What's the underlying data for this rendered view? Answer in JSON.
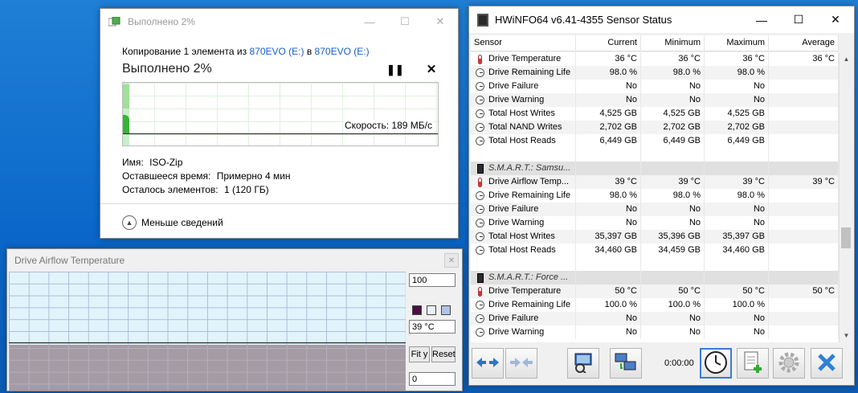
{
  "copy_dialog": {
    "title": "Выполнено 2%",
    "copy_line_prefix": "Копирование 1 элемента из ",
    "source": "870EVO (E:)",
    "copy_line_mid": " в ",
    "destination": "870EVO (E:)",
    "done_label": "Выполнено 2%",
    "progress_percent": 2,
    "speed_label": "Скорость: 189 МБ/с",
    "pause_symbol": "❚❚",
    "stop_symbol": "✕",
    "name_label": "Имя:",
    "name_value": "ISO-Zip",
    "time_label": "Оставшееся время:",
    "time_value": "Примерно 4 мин",
    "items_label": "Осталось элементов:",
    "items_value": "1 (120 ГБ)",
    "less_details": "Меньше сведений",
    "caption": {
      "minimize": "—",
      "maximize": "☐",
      "close": "✕"
    }
  },
  "airflow_graph": {
    "title": "Drive Airflow Temperature",
    "close_symbol": "✕",
    "max_value": "100",
    "current_value": "39 °C",
    "min_value": "0",
    "fit_label": "Fit y",
    "reset_label": "Reset",
    "level_fraction": 0.39,
    "swatch_colors": [
      "#4a1040",
      "#e8f4fb",
      "#b0c4e8"
    ]
  },
  "hwinfo": {
    "title": "HWiNFO64 v6.41-4355 Sensor Status",
    "caption": {
      "minimize": "—",
      "maximize": "☐",
      "close": "✕"
    },
    "columns": [
      "Sensor",
      "Current",
      "Minimum",
      "Maximum",
      "Average"
    ],
    "rows": [
      {
        "type": "thermo",
        "name": "Drive Temperature",
        "cur": "36 °C",
        "min": "36 °C",
        "max": "36 °C",
        "avg": "36 °C"
      },
      {
        "type": "clock",
        "name": "Drive Remaining Life",
        "cur": "98.0 %",
        "min": "98.0 %",
        "max": "98.0 %",
        "avg": ""
      },
      {
        "type": "clock",
        "name": "Drive Failure",
        "cur": "No",
        "min": "No",
        "max": "No",
        "avg": ""
      },
      {
        "type": "clock",
        "name": "Drive Warning",
        "cur": "No",
        "min": "No",
        "max": "No",
        "avg": ""
      },
      {
        "type": "clock",
        "name": "Total Host Writes",
        "cur": "4,525 GB",
        "min": "4,525 GB",
        "max": "4,525 GB",
        "avg": ""
      },
      {
        "type": "clock",
        "name": "Total NAND Writes",
        "cur": "2,702 GB",
        "min": "2,702 GB",
        "max": "2,702 GB",
        "avg": ""
      },
      {
        "type": "clock",
        "name": "Total Host Reads",
        "cur": "6,449 GB",
        "min": "6,449 GB",
        "max": "6,449 GB",
        "avg": ""
      },
      {
        "type": "blank",
        "name": "",
        "cur": "",
        "min": "",
        "max": "",
        "avg": ""
      },
      {
        "type": "group",
        "name": "S.M.A.R.T.: Samsu...",
        "cur": "",
        "min": "",
        "max": "",
        "avg": ""
      },
      {
        "type": "thermo",
        "name": "Drive Airflow Temp...",
        "cur": "39 °C",
        "min": "39 °C",
        "max": "39 °C",
        "avg": "39 °C"
      },
      {
        "type": "clock",
        "name": "Drive Remaining Life",
        "cur": "98.0 %",
        "min": "98.0 %",
        "max": "98.0 %",
        "avg": ""
      },
      {
        "type": "clock",
        "name": "Drive Failure",
        "cur": "No",
        "min": "No",
        "max": "No",
        "avg": ""
      },
      {
        "type": "clock",
        "name": "Drive Warning",
        "cur": "No",
        "min": "No",
        "max": "No",
        "avg": ""
      },
      {
        "type": "clock",
        "name": "Total Host Writes",
        "cur": "35,397 GB",
        "min": "35,396 GB",
        "max": "35,397 GB",
        "avg": ""
      },
      {
        "type": "clock",
        "name": "Total Host Reads",
        "cur": "34,460 GB",
        "min": "34,459 GB",
        "max": "34,460 GB",
        "avg": ""
      },
      {
        "type": "blank",
        "name": "",
        "cur": "",
        "min": "",
        "max": "",
        "avg": ""
      },
      {
        "type": "group",
        "name": "S.M.A.R.T.: Force ...",
        "cur": "",
        "min": "",
        "max": "",
        "avg": ""
      },
      {
        "type": "thermo",
        "name": "Drive Temperature",
        "cur": "50 °C",
        "min": "50 °C",
        "max": "50 °C",
        "avg": "50 °C"
      },
      {
        "type": "clock",
        "name": "Drive Remaining Life",
        "cur": "100.0 %",
        "min": "100.0 %",
        "max": "100.0 %",
        "avg": ""
      },
      {
        "type": "clock",
        "name": "Drive Failure",
        "cur": "No",
        "min": "No",
        "max": "No",
        "avg": ""
      },
      {
        "type": "clock",
        "name": "Drive Warning",
        "cur": "No",
        "min": "No",
        "max": "No",
        "avg": ""
      }
    ],
    "timer": "0:00:00",
    "toolbar_icons": [
      "expand-arrows-icon",
      "collapse-arrows-icon",
      "network-computer-icon",
      "network-switch-icon",
      "clock-icon",
      "add-report-icon",
      "settings-gear-icon",
      "close-x-icon"
    ]
  }
}
